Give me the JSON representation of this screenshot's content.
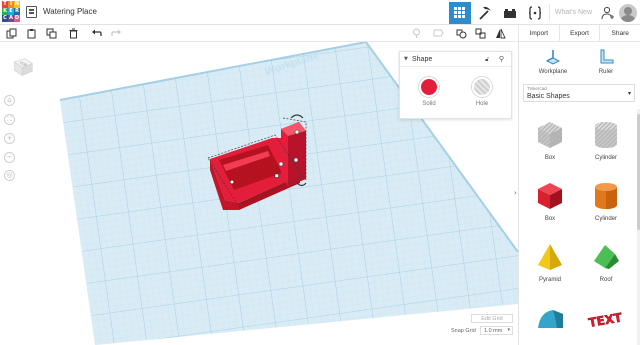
{
  "header": {
    "logo_letters": [
      "T",
      "I",
      "N",
      "K",
      "E",
      "R",
      "C",
      "A",
      "D"
    ],
    "logo_colors": [
      "#e2473a",
      "#f18a22",
      "#f6c21a",
      "#3fa54a",
      "#26a7d8",
      "#1f6cae",
      "#2e4f9f",
      "#6b4a9e",
      "#e05b8c"
    ],
    "design_title": "Watering Place",
    "whats_new": "What's New",
    "accent": "#2f8ccb"
  },
  "toolbar": {
    "icons": [
      "copy-icon",
      "paste-icon",
      "duplicate-icon",
      "delete-icon",
      "undo-icon",
      "redo-icon",
      "note-icon",
      "speech-icon",
      "comment-icon",
      "group-icon",
      "ungroup-icon",
      "align-icon",
      "mirror-icon"
    ]
  },
  "actions": {
    "import": "Import",
    "export": "Export",
    "share": "Share"
  },
  "viewcube": {
    "label": "TOP"
  },
  "workplane": {
    "label": "Workplane"
  },
  "inspector": {
    "title": "Shape",
    "solid_label": "Solid",
    "hole_label": "Hole",
    "solid_color": "#e31d3a"
  },
  "grid": {
    "edit_grid": "Edit Grid",
    "snap_label": "Snap Grid",
    "snap_value": "1.0 mm"
  },
  "panel": {
    "workplane": "Workplane",
    "ruler": "Ruler",
    "library_small": "Tinkercad",
    "library": "Basic Shapes",
    "shapes": [
      {
        "name": "Box",
        "color": "#c4c4c4"
      },
      {
        "name": "Cylinder",
        "color": "#c4c4c4"
      },
      {
        "name": "Box",
        "color": "#d8202f"
      },
      {
        "name": "Cylinder",
        "color": "#e1781b"
      },
      {
        "name": "Pyramid",
        "color": "#f3c919"
      },
      {
        "name": "Roof",
        "color": "#3aa641"
      },
      {
        "name": "",
        "color": "#33a5c9"
      },
      {
        "name": "",
        "color": "#d8202f"
      }
    ],
    "text_shape": "TEXT"
  }
}
